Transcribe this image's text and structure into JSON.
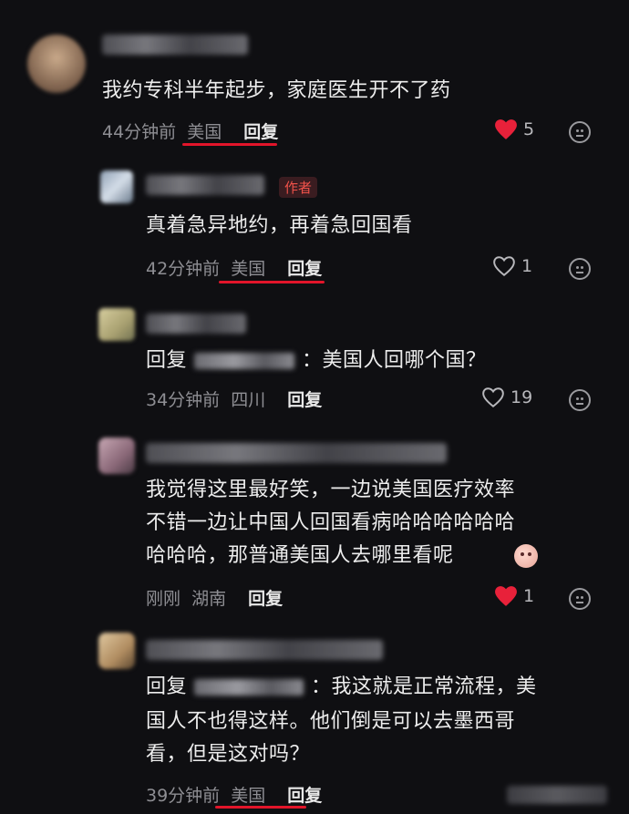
{
  "comments": [
    {
      "text": "我约专科半年起步，家庭医生开不了药",
      "time": "44分钟前",
      "location": "美国",
      "reply_label": "回复",
      "likes": "5",
      "liked": true
    },
    {
      "author_tag": "作者",
      "text": "真着急异地约，再着急回国看",
      "time": "42分钟前",
      "location": "美国",
      "reply_label": "回复",
      "likes": "1",
      "liked": false
    },
    {
      "reply_prefix": "回复",
      "reply_suffix": "：美国人回哪个国？",
      "time": "34分钟前",
      "location": "四川",
      "reply_label": "回复",
      "likes": "19",
      "liked": false
    },
    {
      "text_lines": [
        "我觉得这里最好笑，一边说美国医疗效率",
        "不错一边让中国人回国看病哈哈哈哈哈哈",
        "哈哈哈，那普通美国人去哪里看呢"
      ],
      "time": "刚刚",
      "location": "湖南",
      "reply_label": "回复",
      "likes": "1",
      "liked": true
    },
    {
      "reply_prefix": "回复",
      "reply_suffix": "：我这就是正常流程，美",
      "text_lines": [
        "国人不也得这样。他们倒是可以去墨西哥",
        "看，但是这对吗？"
      ],
      "time": "39分钟前",
      "location": "美国",
      "reply_label": "回复"
    }
  ],
  "colors": {
    "background": "#0f0f12",
    "liked_heart": "#e8213a",
    "underline": "#e2152a",
    "author_tag": "#f0524a"
  }
}
